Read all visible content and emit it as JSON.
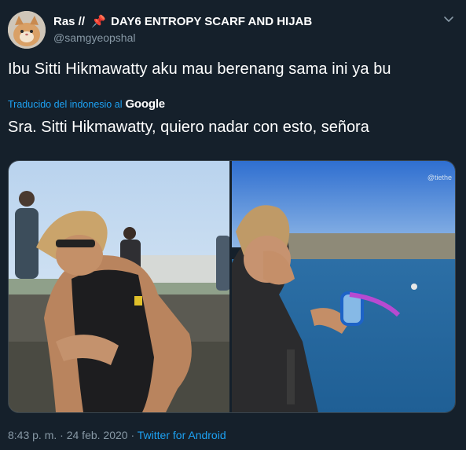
{
  "tweet": {
    "display_name": "Ras //",
    "display_name_rest": "DAY6 ENTROPY SCARF AND HIJAB",
    "pin_emoji": "📌",
    "handle": "@samgyeopshal",
    "text": "Ibu Sitti Hikmawatty aku mau berenang sama ini ya bu",
    "translation_label": "Traducido del indonesio al",
    "translation_provider": "Google",
    "translated_text": "Sra. Sitti Hikmawatty, quiero nadar con esto, señora",
    "watermark": "@tiethe",
    "time": "8:43 p. m.",
    "separator": "·",
    "date": "24 feb. 2020",
    "client": "Twitter for Android"
  },
  "icons": {
    "avatar": "cat-avatar",
    "pin": "pushpin-icon",
    "menu": "chevron-down-icon"
  },
  "colors": {
    "background": "#15202b",
    "text": "#ffffff",
    "secondary_text": "#8899a6",
    "link": "#1da1f2"
  }
}
